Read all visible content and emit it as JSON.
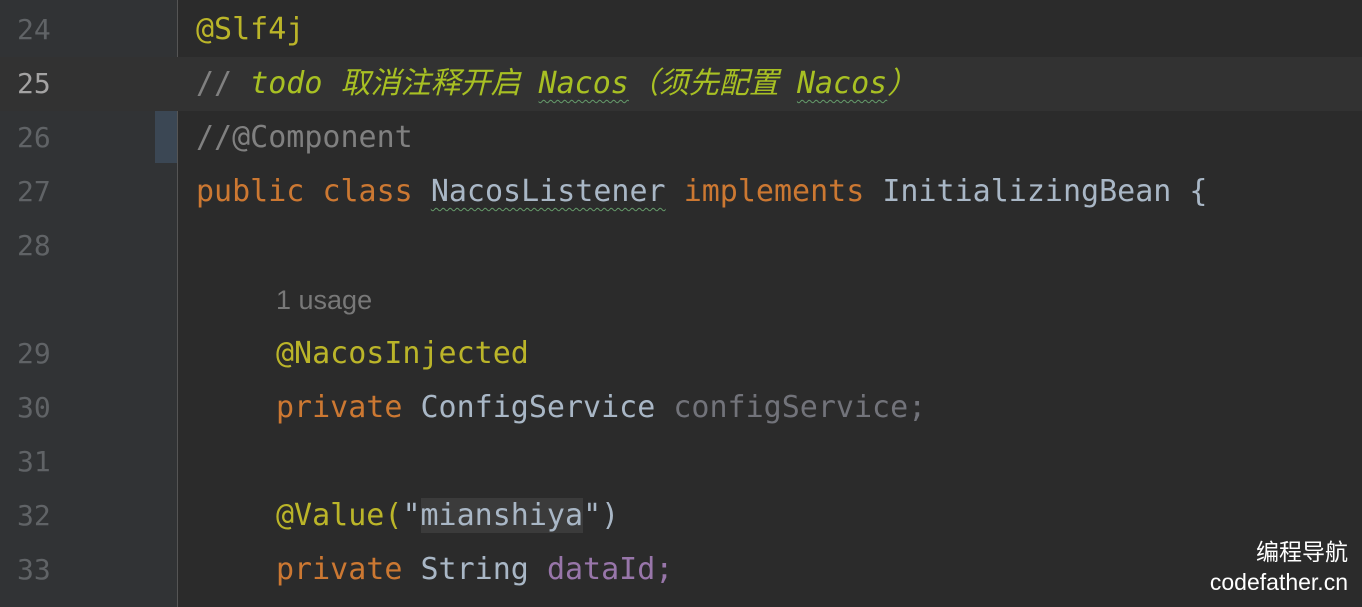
{
  "editor": {
    "lines": [
      {
        "num": "24"
      },
      {
        "num": "25"
      },
      {
        "num": "26"
      },
      {
        "num": "27"
      },
      {
        "num": "28"
      },
      {
        "num": ""
      },
      {
        "num": "29"
      },
      {
        "num": "30"
      },
      {
        "num": "31"
      },
      {
        "num": "32"
      },
      {
        "num": "33"
      }
    ],
    "code": {
      "l24_annotation": "@Slf4j",
      "l25_comment_prefix": "// ",
      "l25_todo": "todo 取消注释开启 ",
      "l25_nacos1": "Nacos",
      "l25_paren_open": "（须先配置 ",
      "l25_nacos2": "Nacos",
      "l25_paren_close": "）",
      "l26_comment": "//@Component",
      "l27_public": "public",
      "l27_class": "class",
      "l27_name": "NacosListener",
      "l27_implements": "implements",
      "l27_interface": "InitializingBean",
      "l27_brace": "{",
      "inlay_usage": "1 usage",
      "l29_annotation": "@NacosInjected",
      "l30_private": "private",
      "l30_type": "ConfigService",
      "l30_var": "configService;",
      "l32_annotation": "@Value(",
      "l32_quote_open": "\"",
      "l32_string": "mianshiya",
      "l32_quote_close": "\"",
      "l32_close": ")",
      "l33_private": "private",
      "l33_type": "String",
      "l33_field": "dataId;"
    }
  },
  "watermark": {
    "line1": "编程导航",
    "line2": "codefather.cn"
  },
  "colors": {
    "background": "#2b2b2b",
    "gutter": "#313335",
    "keyword": "#cc7832",
    "annotation": "#bbb529",
    "comment": "#808080",
    "todo": "#a8c023",
    "field": "#9876aa"
  }
}
